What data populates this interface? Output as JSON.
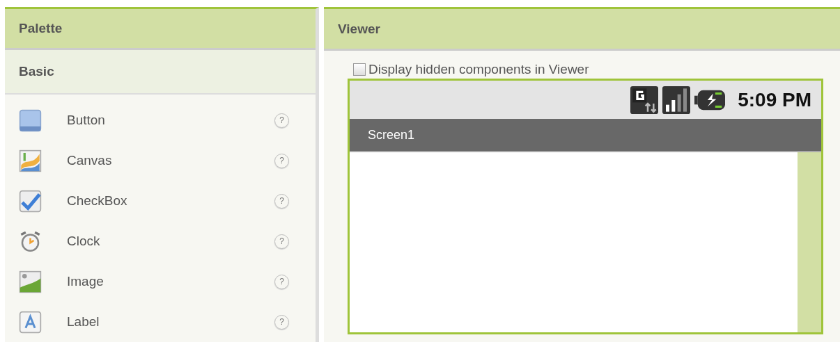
{
  "palette": {
    "title": "Palette",
    "category": "Basic",
    "items": [
      {
        "kind": "button",
        "label": "Button",
        "help": "?"
      },
      {
        "kind": "canvas",
        "label": "Canvas",
        "help": "?"
      },
      {
        "kind": "checkbox",
        "label": "CheckBox",
        "help": "?"
      },
      {
        "kind": "clock",
        "label": "Clock",
        "help": "?"
      },
      {
        "kind": "image",
        "label": "Image",
        "help": "?"
      },
      {
        "kind": "label",
        "label": "Label",
        "help": "?"
      }
    ]
  },
  "viewer": {
    "title": "Viewer",
    "hidden_toggle": {
      "label": "Display hidden components in Viewer",
      "checked": false
    },
    "phone": {
      "time": "5:09 PM",
      "screen_title": "Screen1"
    }
  }
}
